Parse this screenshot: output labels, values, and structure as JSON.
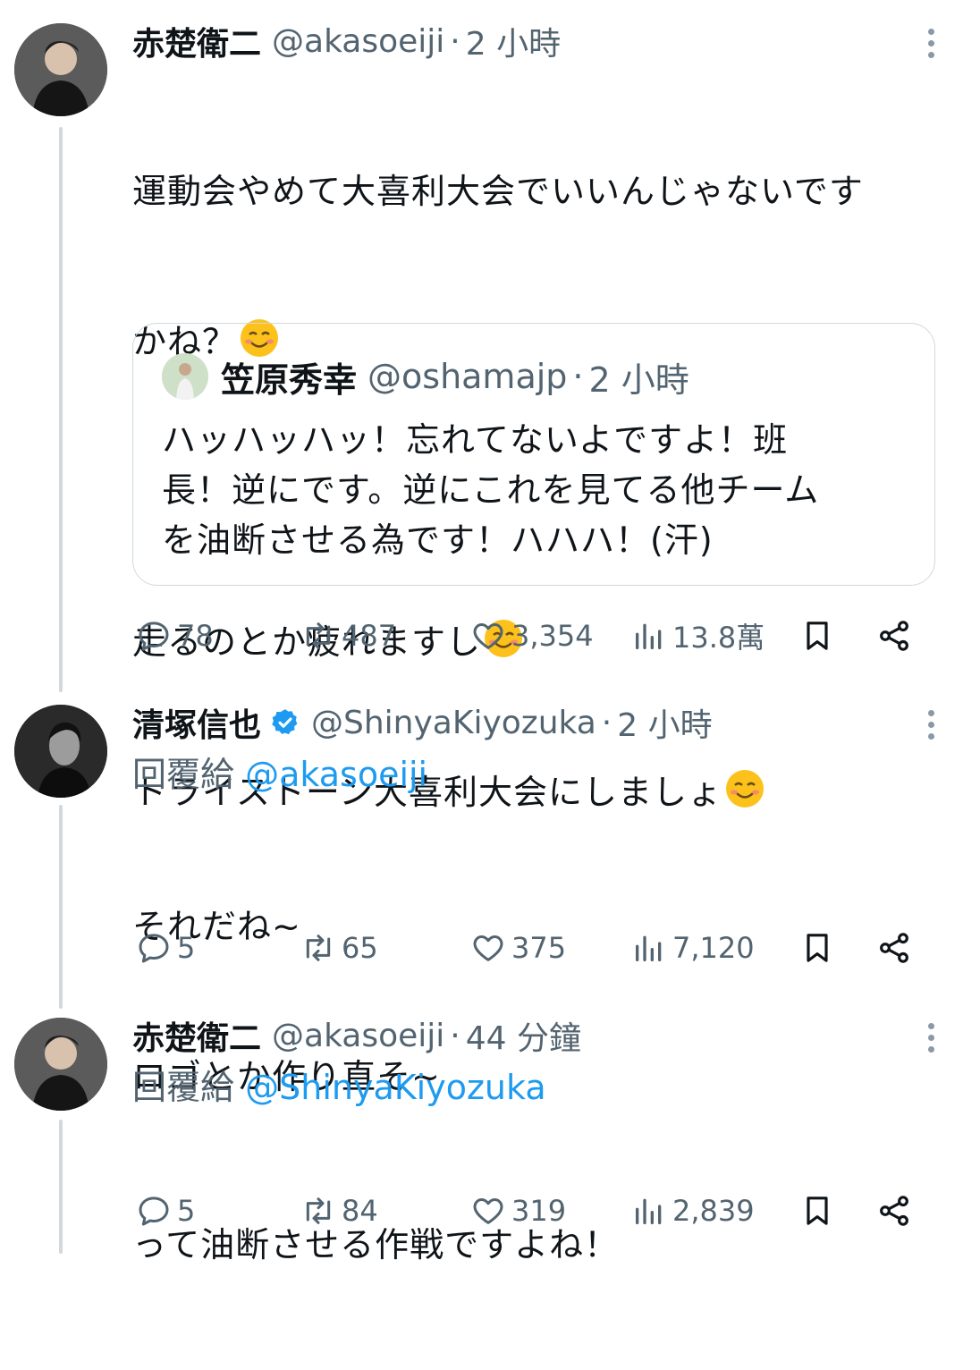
{
  "tweets": [
    {
      "name": "赤楚衛二",
      "handle": "@akasoeiji",
      "time": "2 小時",
      "body_line1": "運動会やめて大喜利大会でいいんじゃないです",
      "body_line2": "かね？",
      "body_line3": "走るのとか疲れますし",
      "body_line4": "トライストーン大喜利大会にしましょ",
      "quote": {
        "name": "笠原秀幸",
        "handle": "@oshamajp",
        "time": "2 小時",
        "line1": "ハッハッハッ！忘れてないよですよ！班",
        "line2": "長！逆にです。逆にこれを見てる他チーム",
        "line3": "を油断させる為です！ハハハ！(汗)"
      },
      "stats": {
        "replies": "78",
        "retweets": "487",
        "likes": "3,354",
        "views": "13.8萬"
      }
    },
    {
      "name": "清塚信也",
      "handle": "@ShinyaKiyozuka",
      "time": "2 小時",
      "verified": true,
      "reply_prefix": "回覆給",
      "reply_to": "@akasoeiji",
      "body_line1": "それだね~",
      "body_line2": "ロゴとか作り直そ~",
      "stats": {
        "replies": "5",
        "retweets": "65",
        "likes": "375",
        "views": "7,120"
      }
    },
    {
      "name": "赤楚衛二",
      "handle": "@akasoeiji",
      "time": "44 分鐘",
      "reply_prefix": "回覆給",
      "reply_to": "@ShinyaKiyozuka",
      "body_line1": "って油断させる作戦ですよね！",
      "stats": {
        "replies": "5",
        "retweets": "84",
        "likes": "319",
        "views": "2,839"
      }
    }
  ],
  "separator_dot": "·",
  "icons": {
    "reply": "reply-icon",
    "retweet": "retweet-icon",
    "like": "heart-icon",
    "views": "views-icon",
    "bookmark": "bookmark-icon",
    "share": "share-icon",
    "more": "more-icon",
    "verified": "verified-badge-icon",
    "emoji": "smiling-face-emoji"
  },
  "colors": {
    "text": "#0f1419",
    "secondary": "#536471",
    "link": "#1d9bf0",
    "thread": "#cfd9de"
  }
}
